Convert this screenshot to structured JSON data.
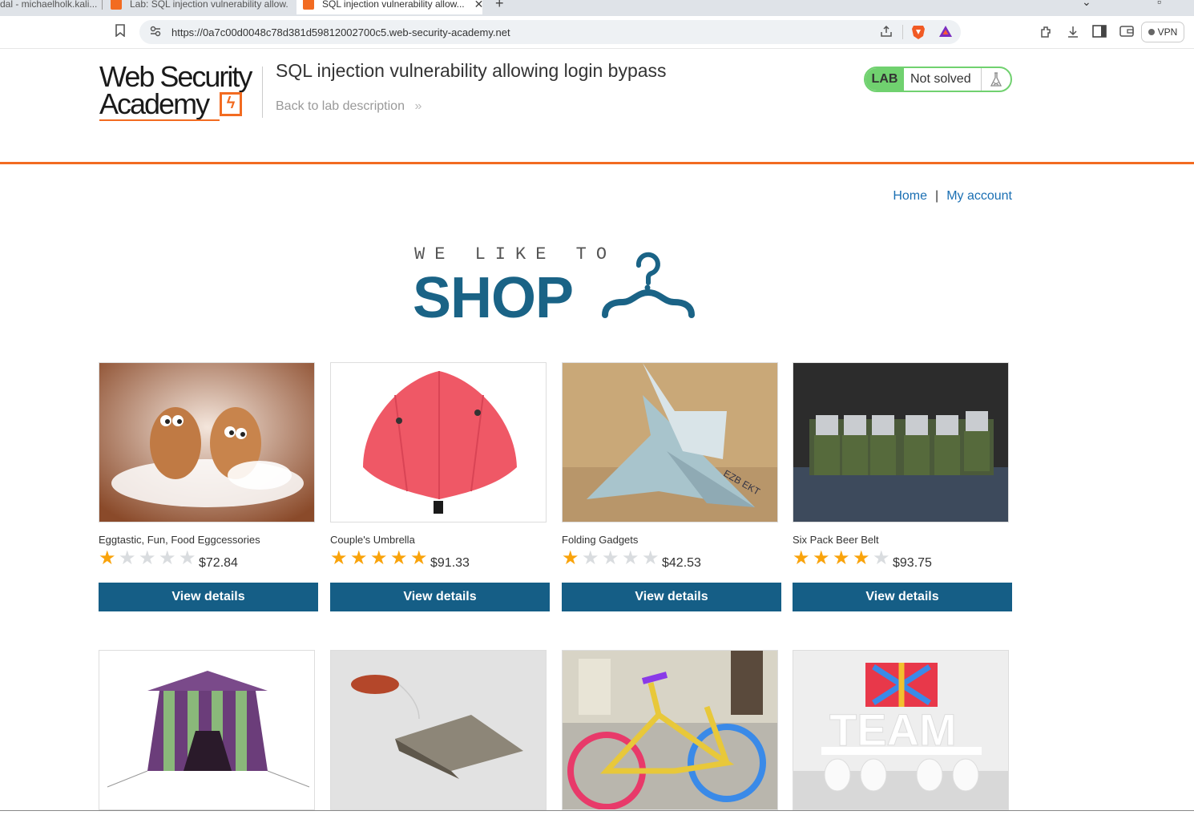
{
  "browser": {
    "tabs": [
      {
        "label": "dal - michaelholk.kali..."
      },
      {
        "label": "Lab: SQL injection vulnerability allow..."
      },
      {
        "label": "SQL injection vulnerability allow...",
        "active": true
      }
    ],
    "url": "https://0a7c00d0048c78d381d59812002700c5.web-security-academy.net",
    "vpn_label": "VPN"
  },
  "header": {
    "logo_line1": "Web Security",
    "logo_line2": "Academy",
    "lab_title": "SQL injection vulnerability allowing login bypass",
    "back_link": "Back to lab description",
    "lab_tag": "LAB",
    "lab_state": "Not solved"
  },
  "nav": {
    "home": "Home",
    "separator": "|",
    "account": "My account"
  },
  "banner": {
    "small": "WE LIKE TO",
    "big": "SHOP"
  },
  "colors": {
    "accent_orange": "#f26b21",
    "button_blue": "#155e86",
    "link_blue": "#1a6fb3",
    "star_gold": "#f9a30b",
    "lab_green": "#70d16f"
  },
  "products": [
    {
      "name": "Eggtastic, Fun, Food Eggcessories",
      "rating": 1,
      "price": "$72.84",
      "button": "View details"
    },
    {
      "name": "Couple's Umbrella",
      "rating": 5,
      "price": "$91.33",
      "button": "View details"
    },
    {
      "name": "Folding Gadgets",
      "rating": 1,
      "price": "$42.53",
      "button": "View details"
    },
    {
      "name": "Six Pack Beer Belt",
      "rating": 4,
      "price": "$93.75",
      "button": "View details"
    },
    {
      "name": "",
      "rating": 0,
      "price": "",
      "button": ""
    },
    {
      "name": "",
      "rating": 0,
      "price": "",
      "button": ""
    },
    {
      "name": "",
      "rating": 0,
      "price": "",
      "button": ""
    },
    {
      "name": "",
      "rating": 0,
      "price": "",
      "button": ""
    }
  ]
}
